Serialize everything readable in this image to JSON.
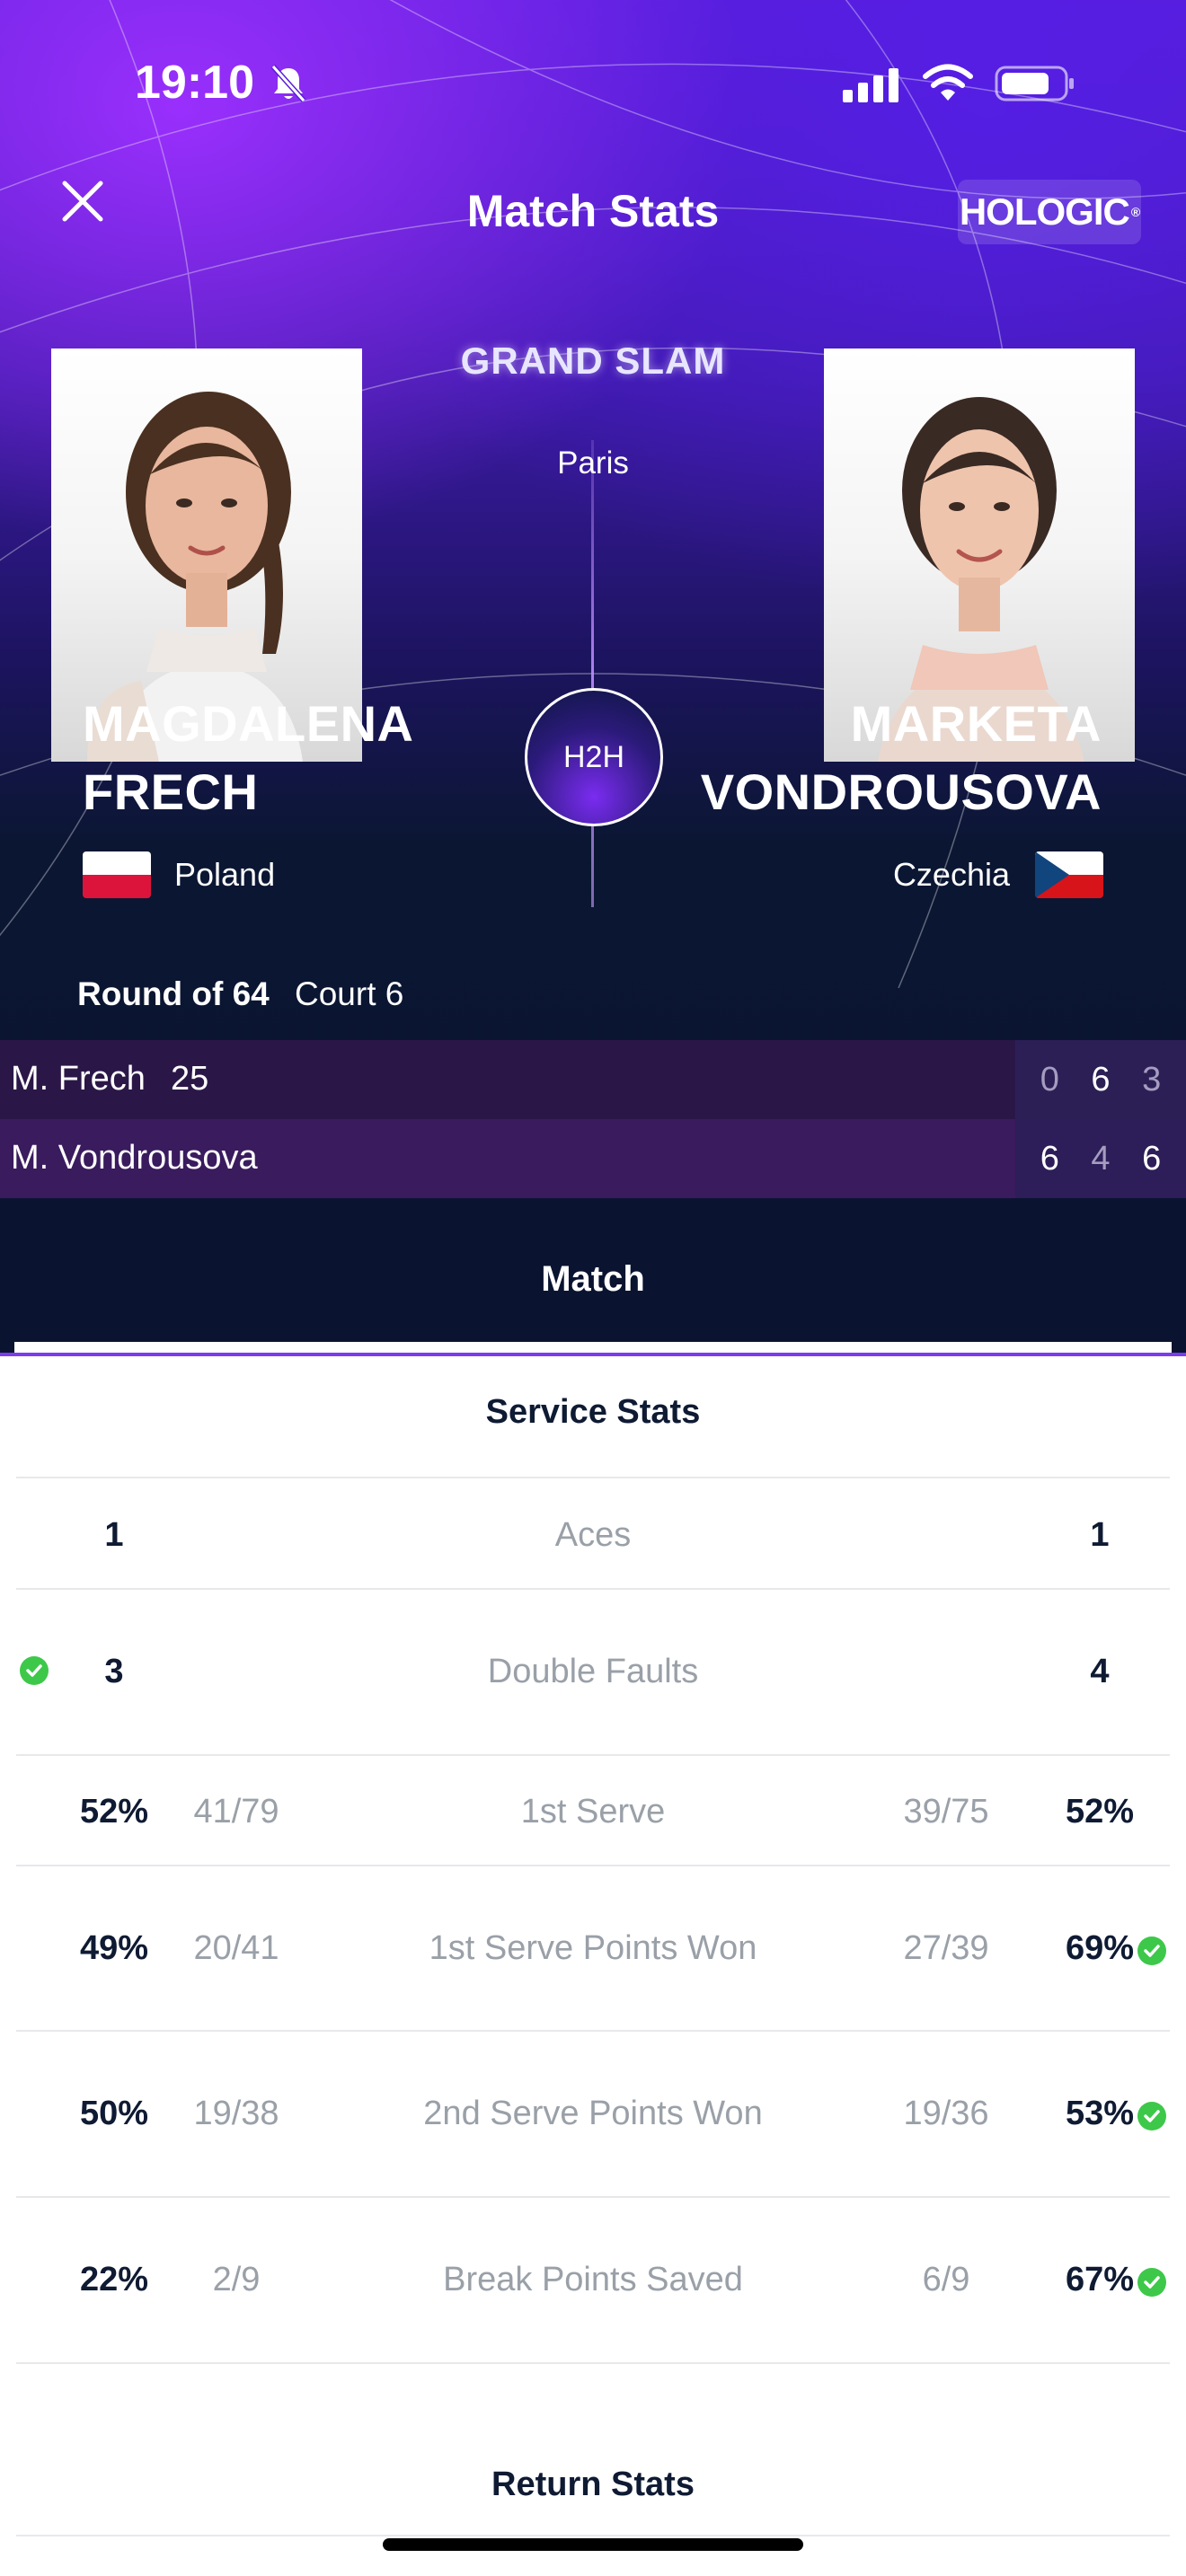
{
  "status_bar": {
    "time": "19:10"
  },
  "header": {
    "title": "Match Stats",
    "sponsor": "HOLOGIC",
    "sponsor_mark": "®"
  },
  "event": {
    "tier": "GRAND SLAM",
    "city": "Paris",
    "h2h_label": "H2H"
  },
  "players": {
    "left": {
      "first": "MAGDALENA",
      "last": "FRECH",
      "country": "Poland",
      "flag": "poland-flag"
    },
    "right": {
      "first": "MARKETA",
      "last": "VONDROUSOVA",
      "country": "Czechia",
      "flag": "czechia-flag"
    }
  },
  "match_info": {
    "round": "Round of 64",
    "court": "Court 6"
  },
  "scoreboard": [
    {
      "name": "M. Frech",
      "seed": "25",
      "sets": [
        "0",
        "6",
        "3"
      ],
      "set_won": [
        false,
        true,
        false
      ]
    },
    {
      "name": "M. Vondrousova",
      "seed": "",
      "sets": [
        "6",
        "4",
        "6"
      ],
      "set_won": [
        true,
        false,
        true
      ]
    }
  ],
  "tabs": {
    "active": "Match"
  },
  "service_stats": {
    "title": "Service Stats",
    "rows": [
      {
        "label": "Aces",
        "left_value": "1",
        "right_value": "1",
        "left_frac": "",
        "right_frac": ""
      },
      {
        "label": "Double Faults",
        "left_value": "3",
        "right_value": "4",
        "left_frac": "",
        "right_frac": "",
        "advantage": "left"
      },
      {
        "label": "1st Serve",
        "left_value": "52%",
        "right_value": "52%",
        "left_frac": "41/79",
        "right_frac": "39/75"
      },
      {
        "label": "1st Serve Points Won",
        "left_value": "49%",
        "right_value": "69%",
        "left_frac": "20/41",
        "right_frac": "27/39",
        "advantage": "right"
      },
      {
        "label": "2nd Serve Points Won",
        "left_value": "50%",
        "right_value": "53%",
        "left_frac": "19/38",
        "right_frac": "19/36",
        "advantage": "right"
      },
      {
        "label": "Break Points Saved",
        "left_value": "22%",
        "right_value": "67%",
        "left_frac": "2/9",
        "right_frac": "6/9",
        "advantage": "right"
      }
    ]
  },
  "return_stats": {
    "title": "Return Stats"
  },
  "colors": {
    "accent": "#7b3cf0",
    "check": "#3dc84a",
    "dark": "#0a1430"
  }
}
